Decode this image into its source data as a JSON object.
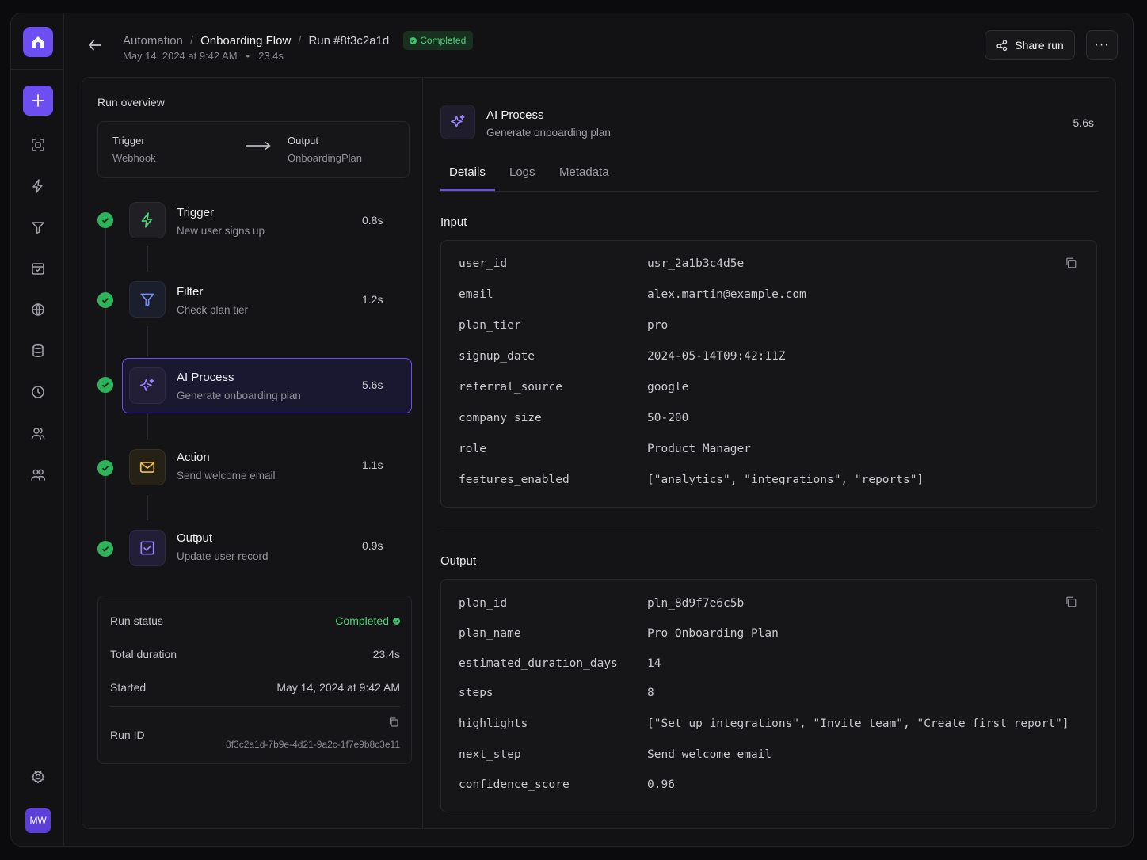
{
  "sidebar": {
    "avatar_initials": "MW",
    "nav_icons": [
      "scan-icon",
      "bolt-icon",
      "filter-icon",
      "package-icon",
      "globe-icon",
      "database-icon",
      "clock-icon",
      "users-icon",
      "team-icon"
    ],
    "settings_icon": "gear-icon"
  },
  "header": {
    "breadcrumbs": [
      "Automation",
      "Onboarding Flow",
      "Run #8f3c2a1d"
    ],
    "separator": "/",
    "status_badge": "Completed",
    "date": "May 14, 2024 at 9:42 AM",
    "dot": "•",
    "duration": "23.4s",
    "share_label": "Share run",
    "more_label": "···"
  },
  "overview": {
    "title": "Run overview",
    "trigger_label": "Trigger",
    "trigger_value": "Webhook",
    "output_label": "Output",
    "output_value": "OnboardingPlan"
  },
  "steps": [
    {
      "title": "Trigger",
      "subtitle": "New user signs up",
      "duration": "0.8s",
      "icon": "bolt-icon"
    },
    {
      "title": "Filter",
      "subtitle": "Check plan tier",
      "duration": "1.2s",
      "icon": "filter-icon"
    },
    {
      "title": "AI Process",
      "subtitle": "Generate onboarding plan",
      "duration": "5.6s",
      "icon": "sparkle-icon"
    },
    {
      "title": "Action",
      "subtitle": "Send welcome email",
      "duration": "1.1s",
      "icon": "mail-icon"
    },
    {
      "title": "Output",
      "subtitle": "Update user record",
      "duration": "0.9s",
      "icon": "checkbox-icon"
    }
  ],
  "run_status": {
    "status_label": "Run status",
    "status_value": "Completed",
    "total_label": "Total duration",
    "total_value": "23.4s",
    "started_label": "Started",
    "started_value": "May 14, 2024 at 9:42 AM",
    "run_id_label": "Run ID",
    "run_id_value": "8f3c2a1d-7b9e-4d21-9a2c-1f7e9b8c3e11"
  },
  "detail": {
    "title": "AI Process",
    "subtitle": "Generate onboarding plan",
    "duration": "5.6s",
    "tabs": [
      "Details",
      "Logs",
      "Metadata"
    ],
    "active_tab": "Details",
    "input_title": "Input",
    "input": [
      {
        "key": "user_id",
        "value": "usr_2a1b3c4d5e"
      },
      {
        "key": "email",
        "value": "alex.martin@example.com"
      },
      {
        "key": "plan_tier",
        "value": "pro"
      },
      {
        "key": "signup_date",
        "value": "2024-05-14T09:42:11Z"
      },
      {
        "key": "referral_source",
        "value": "google"
      },
      {
        "key": "company_size",
        "value": "50-200"
      },
      {
        "key": "role",
        "value": "Product Manager"
      },
      {
        "key": "features_enabled",
        "value": "[\"analytics\", \"integrations\", \"reports\"]"
      }
    ],
    "output_title": "Output",
    "output": [
      {
        "key": "plan_id",
        "value": "pln_8d9f7e6c5b"
      },
      {
        "key": "plan_name",
        "value": "Pro Onboarding Plan"
      },
      {
        "key": "estimated_duration_days",
        "value": "14"
      },
      {
        "key": "steps",
        "value": "8"
      },
      {
        "key": "highlights",
        "value": "[\"Set up integrations\", \"Invite team\", \"Create first report\"]"
      },
      {
        "key": "next_step",
        "value": "Send welcome email"
      },
      {
        "key": "confidence_score",
        "value": "0.96"
      }
    ]
  },
  "colors": {
    "accent": "#6d4ef2",
    "success": "#2fb35a",
    "success_text": "#4fd37a",
    "background": "#121214"
  }
}
